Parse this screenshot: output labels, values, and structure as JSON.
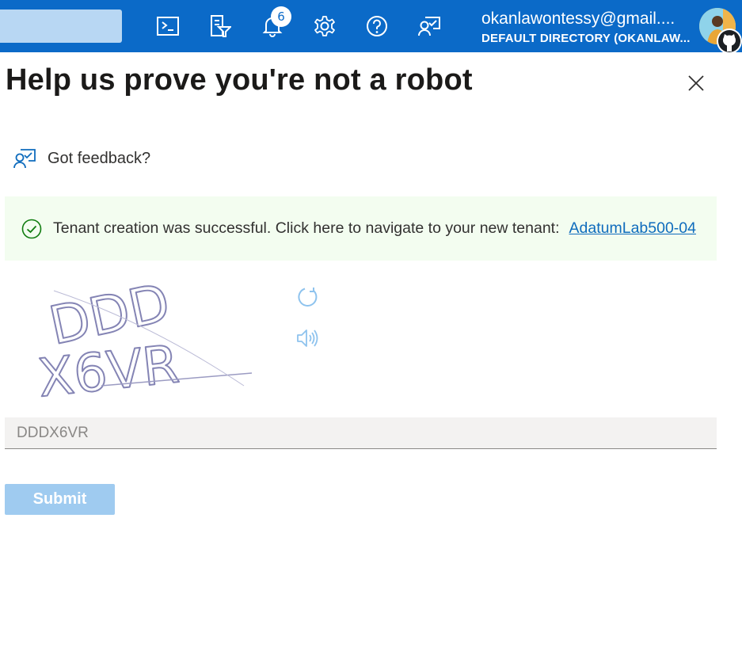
{
  "topbar": {
    "search_placeholder": "",
    "notification_count": "6",
    "account_email": "okanlawontessy@gmail....",
    "account_directory": "DEFAULT DIRECTORY (OKANLAW...",
    "icons": [
      "cloud-shell-icon",
      "directory-filter-icon",
      "notifications-icon",
      "settings-icon",
      "help-icon",
      "feedback-icon"
    ],
    "accent_color": "#0b6ac8"
  },
  "dialog": {
    "title": "Help us prove you're not a robot",
    "feedback_label": "Got feedback?",
    "success_message": "Tenant creation was successful. Click here to navigate to your new tenant:",
    "tenant_link": "AdatumLab500-04",
    "captcha_text": "DDDX6VR",
    "answer_value": "DDDX6VR",
    "submit_label": "Submit",
    "success_color": "#107c10"
  }
}
